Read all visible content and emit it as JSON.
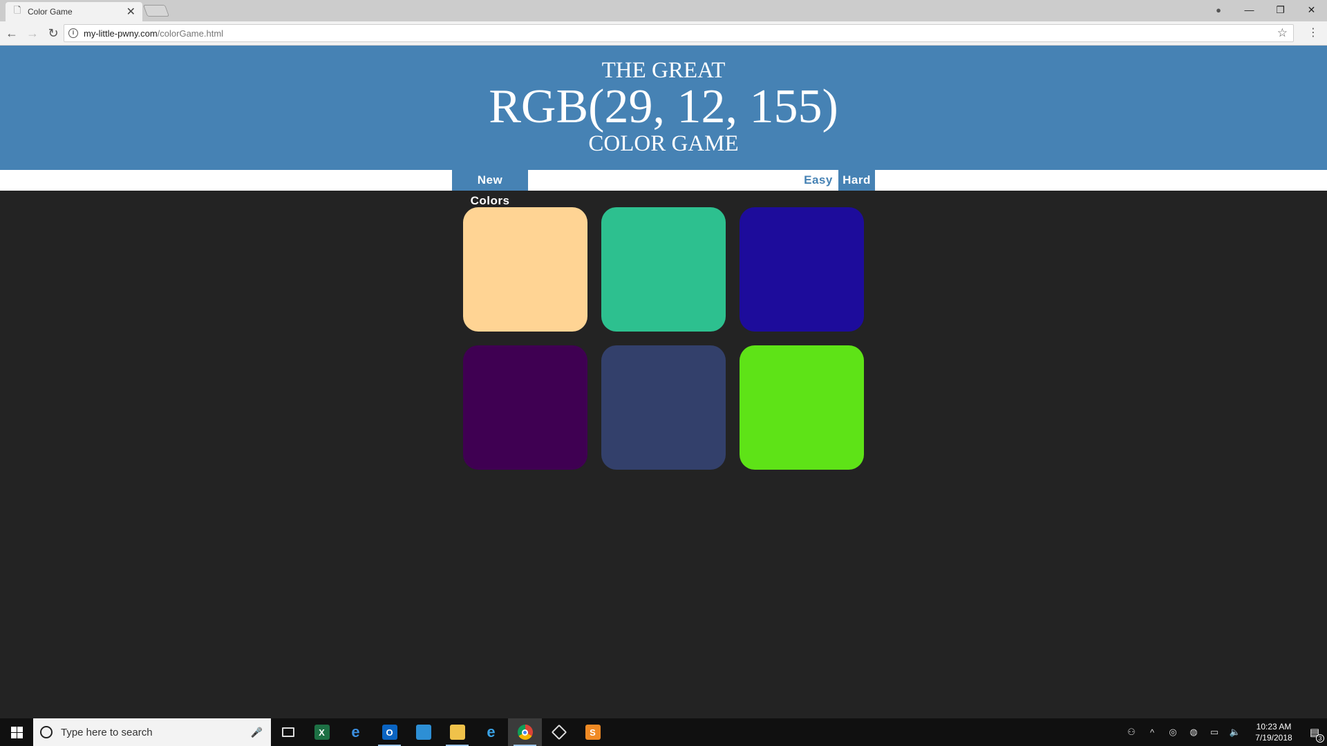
{
  "browser": {
    "tab_title": "Color Game",
    "tab_close": "✕",
    "url_host": "my-little-pwny.com",
    "url_path": "/colorGame.html",
    "window_controls": [
      "—",
      "❐",
      "✕"
    ]
  },
  "game": {
    "header_top": "THE GREAT",
    "color_display": "RGB(29, 12, 155)",
    "header_bottom": "COLOR GAME",
    "new_colors_label": "New Colors",
    "message": "",
    "easy_label": "Easy",
    "hard_label": "Hard",
    "mode_selected": "Hard",
    "accent_color": "#4682b4",
    "background_color": "#232323",
    "squares": [
      {
        "color": "#ffd494"
      },
      {
        "color": "#2dc08f"
      },
      {
        "color": "#1d0c9b"
      },
      {
        "color": "#3f0052"
      },
      {
        "color": "#33406b"
      },
      {
        "color": "#5ee317"
      }
    ]
  },
  "taskbar": {
    "search_placeholder": "Type here to search",
    "apps": [
      "task-view",
      "excel",
      "edge",
      "outlook",
      "photos",
      "file-explorer",
      "internet-explorer",
      "chrome",
      "git",
      "sublime-text"
    ],
    "clock_time": "10:23 AM",
    "clock_date": "7/19/2018",
    "notification_count": "3"
  }
}
